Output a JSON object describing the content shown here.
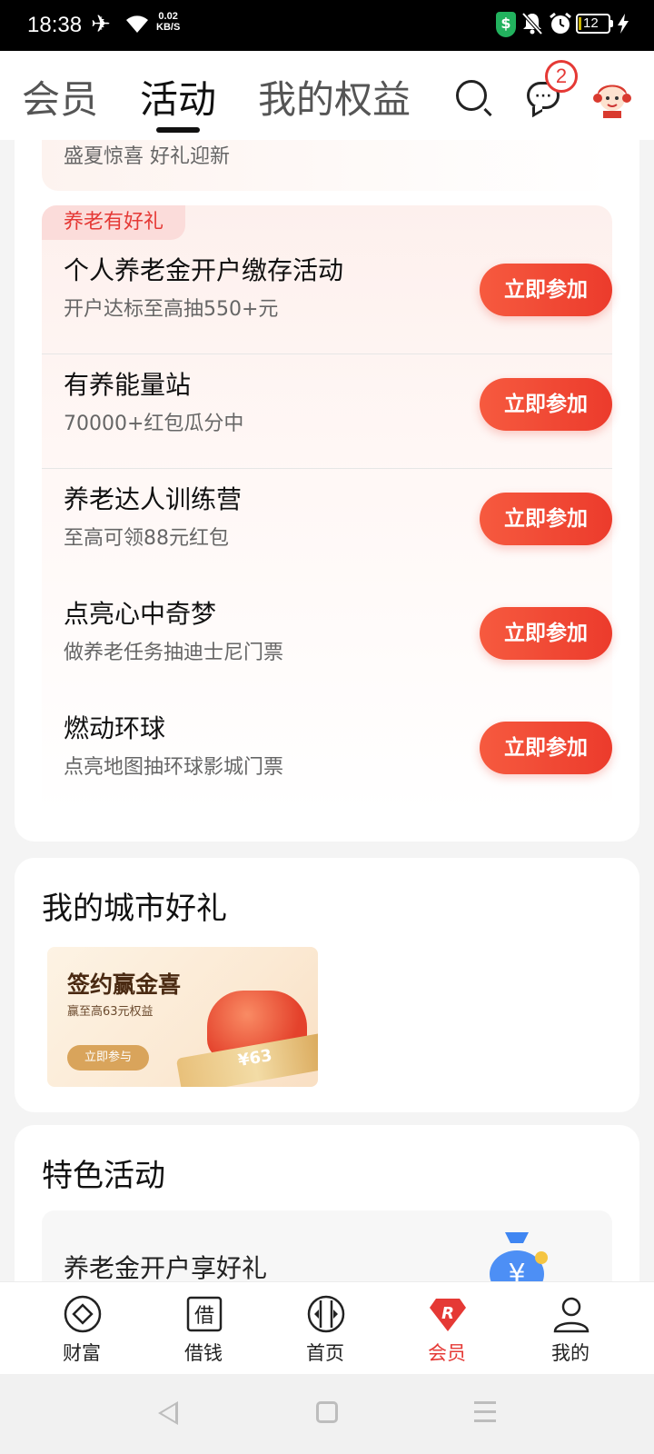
{
  "status_bar": {
    "time": "18:38",
    "net_speed_value": "0.02",
    "net_speed_unit": "KB/S",
    "shield_label": "$",
    "battery": "12",
    "icons": [
      "airplane-icon",
      "wifi-icon",
      "shield-icon",
      "bell-off-icon",
      "alarm-icon",
      "battery-icon",
      "charging-icon"
    ]
  },
  "header": {
    "tabs": [
      {
        "label": "会员"
      },
      {
        "label": "活动"
      },
      {
        "label": "我的权益"
      }
    ],
    "active_tab": "活动",
    "message_badge": "2"
  },
  "activities": {
    "previous_item_subtitle": "盛夏惊喜 好礼迎新",
    "pension_tag": "养老有好礼",
    "items": [
      {
        "title": "个人养老金开户缴存活动",
        "desc": "开户达标至高抽550+元",
        "button": "立即参加"
      },
      {
        "title": "有养能量站",
        "desc": "70000+红包瓜分中",
        "button": "立即参加"
      },
      {
        "title": "养老达人训练营",
        "desc": "至高可领88元红包",
        "button": "立即参加"
      },
      {
        "title": "点亮心中奇梦",
        "desc": "做养老任务抽迪士尼门票",
        "button": "立即参加"
      },
      {
        "title": "燃动环球",
        "desc": "点亮地图抽环球影城门票",
        "button": "立即参加"
      }
    ]
  },
  "city_gifts": {
    "title": "我的城市好礼",
    "banner": {
      "title": "签约赢金喜",
      "subtitle": "赢至高63元权益",
      "button": "立即参与",
      "amount": "¥63"
    }
  },
  "featured": {
    "title": "特色活动",
    "item_title": "养老金开户享好礼"
  },
  "bottom_nav": {
    "items": [
      {
        "label": "财富"
      },
      {
        "label": "借钱"
      },
      {
        "label": "首页"
      },
      {
        "label": "会员"
      },
      {
        "label": "我的"
      }
    ],
    "active": "会员"
  },
  "colors": {
    "accent": "#ec3b2c",
    "tag_bg": "#fbdcda",
    "page_bg": "#f4f4f4"
  }
}
